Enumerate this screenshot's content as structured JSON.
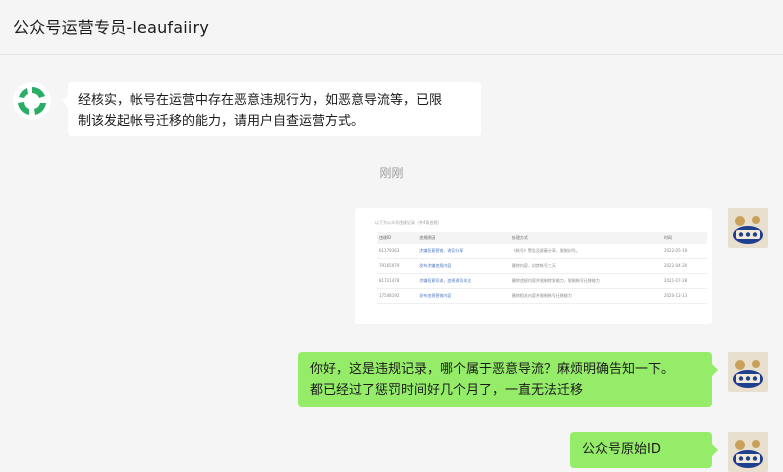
{
  "window": {
    "title": "公众号运营专员-leaufaiiry"
  },
  "colors": {
    "outgoing_bubble": "#95ec69",
    "incoming_bubble": "#ffffff",
    "background": "#f5f5f5",
    "logo_green": "#2aae67"
  },
  "messages": {
    "incoming": {
      "line1": "经核实，帐号在运营中存在恶意违规行为，如恶意导流等，已限",
      "line2": "制该发起帐号迁移的能力，请用户自查运营方式。"
    },
    "timestamp": "刚刚",
    "screenshot": {
      "caption": "以下为公众号违规记录（共4条违规）",
      "headers": [
        "违规ID",
        "违规原因",
        "处理方式",
        "时间"
      ],
      "rows": [
        [
          "61179363",
          "涉嫌恶意营销，诱导分享",
          "《帐号》警告及屏蔽分享，限制封号。",
          "2022-05-19"
        ],
        [
          "79165079",
          "发布涉嫌违规内容",
          "删除内容，封禁帐号三天",
          "2022-04-20"
        ],
        [
          "81721478",
          "涉嫌恶意导流，违规诱导关注",
          "删除违规内容并限制转发能力，限制帐号迁移能力",
          "2021-07-28"
        ],
        [
          "17548192",
          "发布违规营销内容",
          "删除相关内容并限制帐号迁移能力",
          "2020-12-13"
        ]
      ]
    },
    "outgoing1": {
      "line1": "你好，这是违规记录，哪个属于恶意导流？麻烦明确告知一下。",
      "line2": "都已经过了惩罚时间好几个月了，一直无法迁移"
    },
    "outgoing2": {
      "text": "公众号原始ID"
    }
  }
}
